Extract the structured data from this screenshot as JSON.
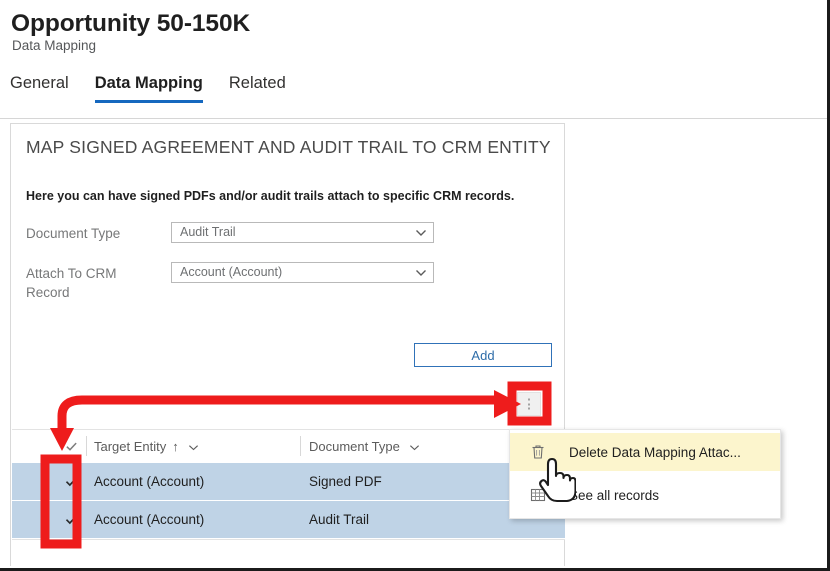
{
  "header": {
    "title": "Opportunity 50-150K",
    "subtitle": "Data Mapping"
  },
  "tabs": [
    {
      "label": "General",
      "active": false
    },
    {
      "label": "Data Mapping",
      "active": true
    },
    {
      "label": "Related",
      "active": false
    }
  ],
  "card": {
    "heading": "MAP SIGNED AGREEMENT AND AUDIT TRAIL TO CRM ENTITY",
    "description": "Here you can have signed PDFs and/or audit trails attach to specific CRM records.",
    "fields": [
      {
        "label": "Document Type",
        "value": "Audit Trail"
      },
      {
        "label": "Attach To CRM Record",
        "value": "Account (Account)"
      }
    ],
    "add_button": "Add"
  },
  "kebab": {
    "name": "more-commands"
  },
  "grid": {
    "columns": [
      {
        "label": "Target Entity",
        "sort": "↑"
      },
      {
        "label": "Document Type",
        "sort": ""
      }
    ],
    "rows": [
      {
        "selected": true,
        "target_entity": "Account (Account)",
        "document_type": "Signed PDF"
      },
      {
        "selected": true,
        "target_entity": "Account (Account)",
        "document_type": "Audit Trail"
      }
    ]
  },
  "context_menu": {
    "items": [
      {
        "label": "Delete Data Mapping Attac...",
        "icon": "trash-icon",
        "highlighted": true
      },
      {
        "label": "See all records",
        "icon": "grid-icon",
        "highlighted": false
      }
    ]
  },
  "colors": {
    "accent": "#1568bf",
    "link": "#2d6ca8",
    "row_selected": "#bfd3e6",
    "menu_highlight": "#fcf5cd",
    "annotation": "#ee1c1c"
  }
}
